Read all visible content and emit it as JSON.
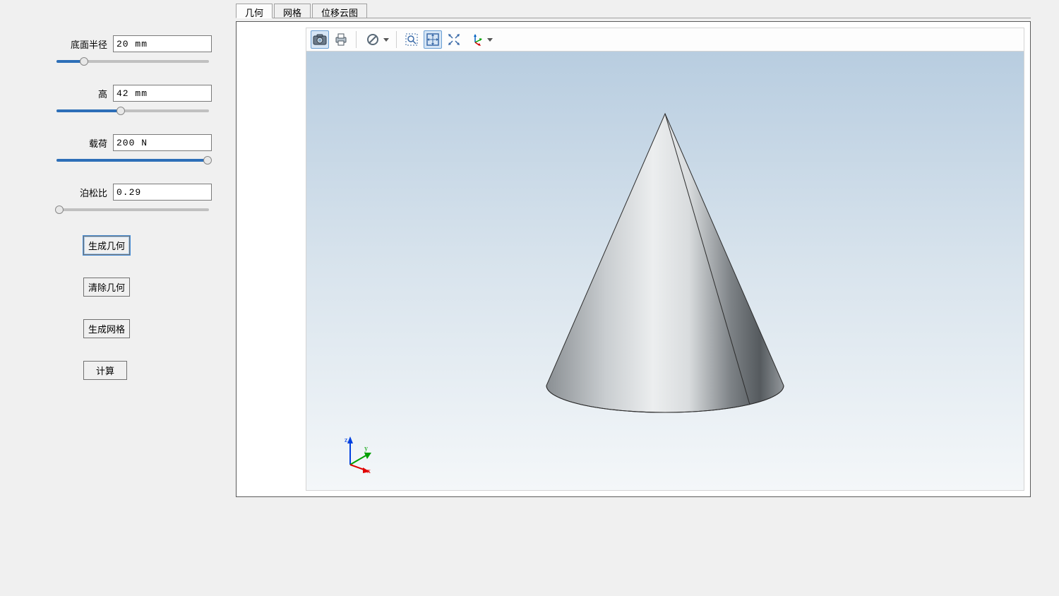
{
  "sidebar": {
    "params": [
      {
        "label": "底面半径",
        "value": "20 mm",
        "slider_pct": 18
      },
      {
        "label": "高",
        "value": "42 mm",
        "slider_pct": 42
      },
      {
        "label": "载荷",
        "value": "200 N",
        "slider_pct": 99
      },
      {
        "label": "泊松比",
        "value": "0.29",
        "slider_pct": 2
      }
    ],
    "buttons": {
      "generate_geometry": "生成几何",
      "clear_geometry": "清除几何",
      "generate_mesh": "生成网格",
      "compute": "计算"
    }
  },
  "tabs": [
    {
      "label": "几何",
      "active": true
    },
    {
      "label": "网格",
      "active": false
    },
    {
      "label": "位移云图",
      "active": false
    }
  ],
  "toolbar": {
    "items": [
      {
        "name": "screenshot-icon"
      },
      {
        "name": "print-icon"
      },
      {
        "sep": true
      },
      {
        "name": "no-symbol-icon",
        "dropdown": true
      },
      {
        "sep": true
      },
      {
        "name": "zoom-region-icon"
      },
      {
        "name": "zoom-extents-icon",
        "active": true
      },
      {
        "name": "zoom-fit-icon"
      },
      {
        "name": "axis-orient-icon",
        "dropdown": true
      }
    ]
  },
  "triad": {
    "x": "x",
    "y": "y",
    "z": "z"
  }
}
